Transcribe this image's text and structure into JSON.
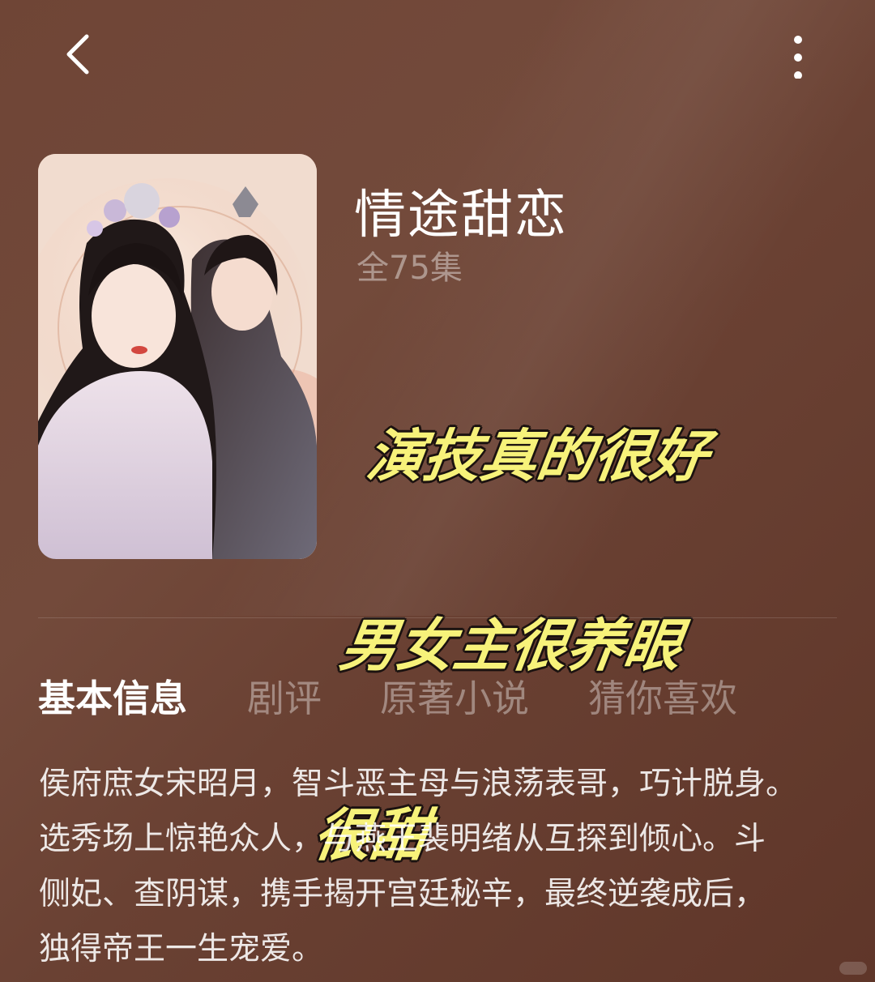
{
  "header": {
    "back_icon": "chevron-left-icon",
    "more_icon": "more-vertical-icon"
  },
  "show": {
    "title": "情途甜恋",
    "episodes": "全75集"
  },
  "sticker": {
    "lines": [
      "演技真的很好",
      "男女主很养眼",
      "很甜"
    ],
    "color": "#f7f27a"
  },
  "tabs": [
    {
      "label": "基本信息",
      "active": true
    },
    {
      "label": "剧评",
      "active": false
    },
    {
      "label": "原著小说",
      "active": false
    },
    {
      "label": "猜你喜欢",
      "active": false
    }
  ],
  "synopsis": {
    "lines": [
      "侯府庶女宋昭月，智斗恶主母与浪荡表哥，巧计脱身。",
      "选秀场上惊艳众人，与燕王裴明绪从互探到倾心。斗",
      "侧妃、查阴谋，携手揭开宫廷秘辛，最终逆袭成后，",
      "独得帝王一生宠爱。"
    ]
  },
  "colors": {
    "background": "#6f4536",
    "tab_active": "#ffffff",
    "tab_inactive": "#b8a39b"
  }
}
